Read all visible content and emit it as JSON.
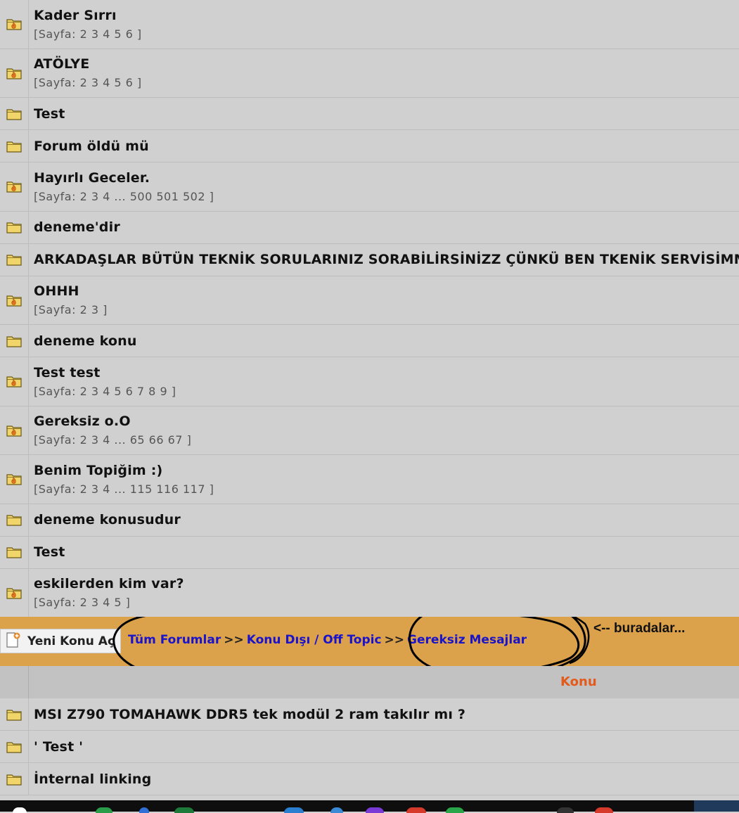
{
  "topics_top": [
    {
      "title": "Kader Sırrı",
      "pages": "[Sayfa: 2 3 4 5 6 ]",
      "icon": "hot-folder-icon"
    },
    {
      "title": "ATÖLYE",
      "pages": "[Sayfa: 2 3 4 5 6 ]",
      "icon": "hot-folder-icon"
    },
    {
      "title": "Test",
      "icon": "folder-icon"
    },
    {
      "title": "Forum öldü mü",
      "icon": "folder-icon"
    },
    {
      "title": "Hayırlı Geceler.",
      "pages": "[Sayfa: 2 3 4 ... 500 501 502 ]",
      "icon": "hot-folder-icon"
    },
    {
      "title": "deneme'dir",
      "icon": "folder-icon"
    },
    {
      "title": "ARKADAŞLAR BÜTÜN TEKNİK SORULARINIZ SORABİLİRSİNİZZ ÇÜNKÜ BEN TKENİK SERVİSİMM",
      "icon": "folder-icon"
    },
    {
      "title": "OHHH",
      "pages": "[Sayfa: 2 3 ]",
      "icon": "hot-folder-icon"
    },
    {
      "title": "deneme konu",
      "icon": "folder-icon"
    },
    {
      "title": "Test test",
      "pages": "[Sayfa: 2 3 4 5 6 7 8 9 ]",
      "icon": "hot-folder-icon"
    },
    {
      "title": "Gereksiz o.O",
      "pages": "[Sayfa: 2 3 4 ... 65 66 67 ]",
      "icon": "hot-folder-icon"
    },
    {
      "title": "Benim Topiğim :)",
      "pages": "[Sayfa: 2 3 4 ... 115 116 117 ]",
      "icon": "hot-folder-icon"
    },
    {
      "title": "deneme konusudur",
      "icon": "folder-icon"
    },
    {
      "title": "Test",
      "icon": "folder-icon"
    },
    {
      "title": "eskilerden kim var?",
      "pages": "[Sayfa: 2 3 4 5 ]",
      "icon": "hot-folder-icon"
    }
  ],
  "navbar": {
    "new_topic_label": "Yeni Konu Aç",
    "breadcrumb": [
      "Tüm Forumlar",
      "Konu Dışı / Off Topic",
      "Gereksiz Mesajlar"
    ],
    "separator": ">>",
    "annotation": "<-- buradalar..."
  },
  "list_header": {
    "konu": "Konu"
  },
  "topics_bottom": [
    {
      "title": "MSI Z790 TOMAHAWK DDR5 tek modül 2 ram takılır mı ?",
      "icon": "folder-icon"
    },
    {
      "title": "' Test '",
      "icon": "folder-icon"
    },
    {
      "title": "İnternal linking",
      "icon": "folder-icon"
    }
  ],
  "colors": {
    "navbar_bg": "#dca14b",
    "link": "#1a13c9",
    "header_accent": "#e35a1b",
    "row_bg": "#d0d0d0"
  }
}
